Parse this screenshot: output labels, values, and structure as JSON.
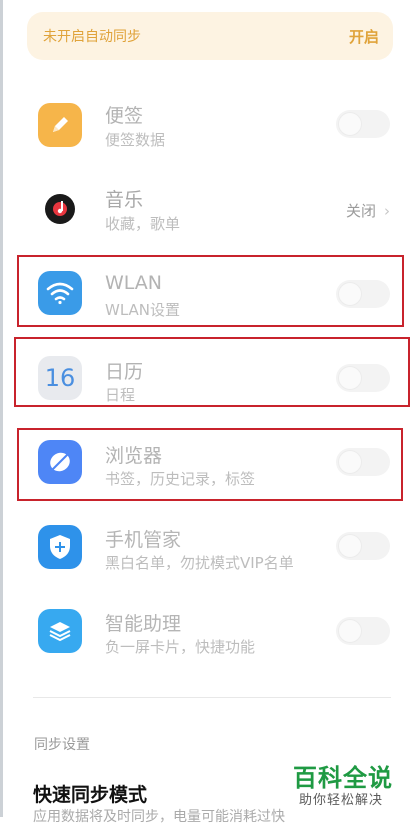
{
  "banner": {
    "text": "未开启自动同步",
    "action": "开启"
  },
  "items": [
    {
      "title": "便签",
      "subtitle": "便签数据",
      "icon": "pencil-note-icon",
      "color": "#f6b54a"
    },
    {
      "title": "音乐",
      "subtitle": "收藏，歌单",
      "icon": "music-disc-icon",
      "status": "关闭"
    },
    {
      "title": "WLAN",
      "subtitle": "WLAN设置",
      "icon": "wifi-icon",
      "color": "#3a9be8"
    },
    {
      "title": "日历",
      "subtitle": "日程",
      "icon": "calendar-icon",
      "day": "16",
      "color": "#4a8fe0"
    },
    {
      "title": "浏览器",
      "subtitle": "书签，历史记录，标签",
      "icon": "browser-icon",
      "color": "#4e86f6"
    },
    {
      "title": "手机管家",
      "subtitle": "黑白名单，勿扰模式VIP名单",
      "icon": "shield-plus-icon",
      "color": "#2e92ea"
    },
    {
      "title": "智能助理",
      "subtitle": "负一屏卡片，快捷功能",
      "icon": "layers-icon",
      "color": "#37a9f0"
    }
  ],
  "section": {
    "label": "同步设置"
  },
  "quick_sync": {
    "title": "快速同步模式",
    "subtitle": "应用数据将及时同步，电量可能消耗过快"
  },
  "watermark": {
    "main": "百科全说",
    "sub": "助你轻松解决"
  }
}
